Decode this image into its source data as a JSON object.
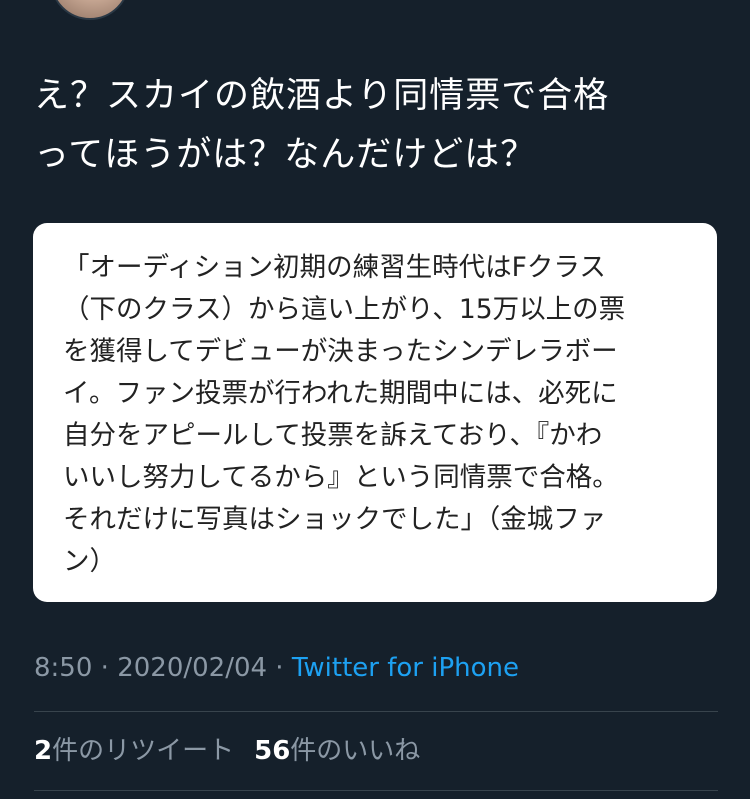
{
  "tweet": {
    "line1": "え？スカイの飲酒より同情票で合格",
    "line2": "ってほうがは？なんだけどは？"
  },
  "quote": {
    "lines": [
      "「オーディション初期の練習生時代はFクラス",
      "（下のクラス）から這い上がり、15万以上の票",
      "を獲得してデビューが決まったシンデレラボー",
      "イ。ファン投票が行われた期間中には、必死に",
      "自分をアピールして投票を訴えており、『かわ",
      "いいし努力してるから』という同情票で合格。",
      "それだけに写真はショックでした」（金城ファ",
      "ン）"
    ]
  },
  "meta": {
    "time": "8:50",
    "sep1": " · ",
    "date": "2020/02/04",
    "sep2": " · ",
    "source": "Twitter for iPhone"
  },
  "stats": {
    "retweets_count": "2",
    "retweets_label": "件のリツイート",
    "likes_count": "56",
    "likes_label": "件のいいね"
  }
}
